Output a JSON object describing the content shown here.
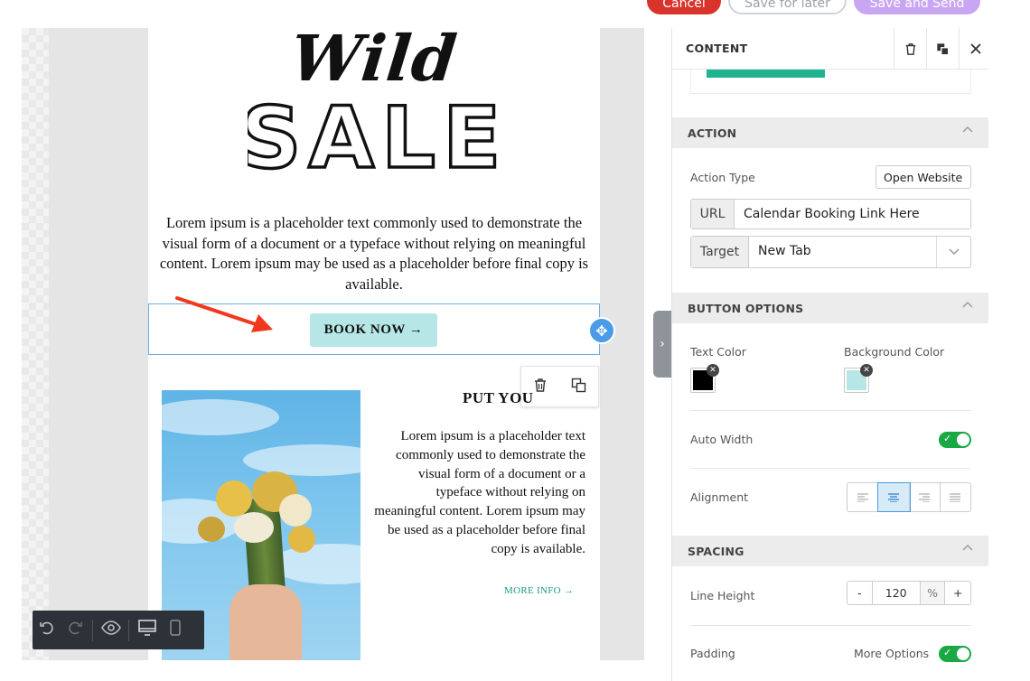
{
  "top_buttons": {
    "cancel": "Cancel",
    "save_later": "Save for later",
    "save_send": "Save and Send"
  },
  "email": {
    "hero_script": "Wild",
    "hero_title": "SALE",
    "body": "Lorem ipsum is a placeholder text commonly used to demonstrate the visual form of a document or a typeface without relying on meaningful content. Lorem ipsum may be used as a placeholder before final copy is available.",
    "cta_label": "BOOK NOW →",
    "section_title": "PUT YOU",
    "side_body": "Lorem ipsum is a placeholder text commonly used to demonstrate the visual form of a document or a typeface without relying on meaningful content. Lorem ipsum may be used as a placeholder before final copy is available.",
    "more_info": "MORE INFO →"
  },
  "panel": {
    "title": "CONTENT",
    "action_section": "ACTION",
    "action_type_label": "Action Type",
    "action_type_value": "Open Website",
    "url_label": "URL",
    "url_value": "Calendar Booking Link Here",
    "target_label": "Target",
    "target_value": "New Tab",
    "button_options_section": "BUTTON OPTIONS",
    "text_color_label": "Text Color",
    "bg_color_label": "Background Color",
    "auto_width_label": "Auto Width",
    "alignment_label": "Alignment",
    "spacing_section": "SPACING",
    "line_height_label": "Line Height",
    "line_height_minus": "-",
    "line_height_value": "120",
    "line_height_unit": "%",
    "line_height_plus": "+",
    "padding_label": "Padding",
    "more_options_label": "More Options"
  },
  "colors": {
    "text_color": "#000000",
    "background_color": "#b6e6e5",
    "accent": "#4a9be8",
    "toggle_on": "#1aa845",
    "annotation_arrow": "#f2381c"
  },
  "icons": {
    "delete": "trash-icon",
    "duplicate": "copy-icon",
    "close": "close-icon",
    "move": "move-icon",
    "undo": "undo-icon",
    "redo": "redo-icon",
    "preview": "eye-icon",
    "desktop": "desktop-icon",
    "mobile": "mobile-icon"
  }
}
